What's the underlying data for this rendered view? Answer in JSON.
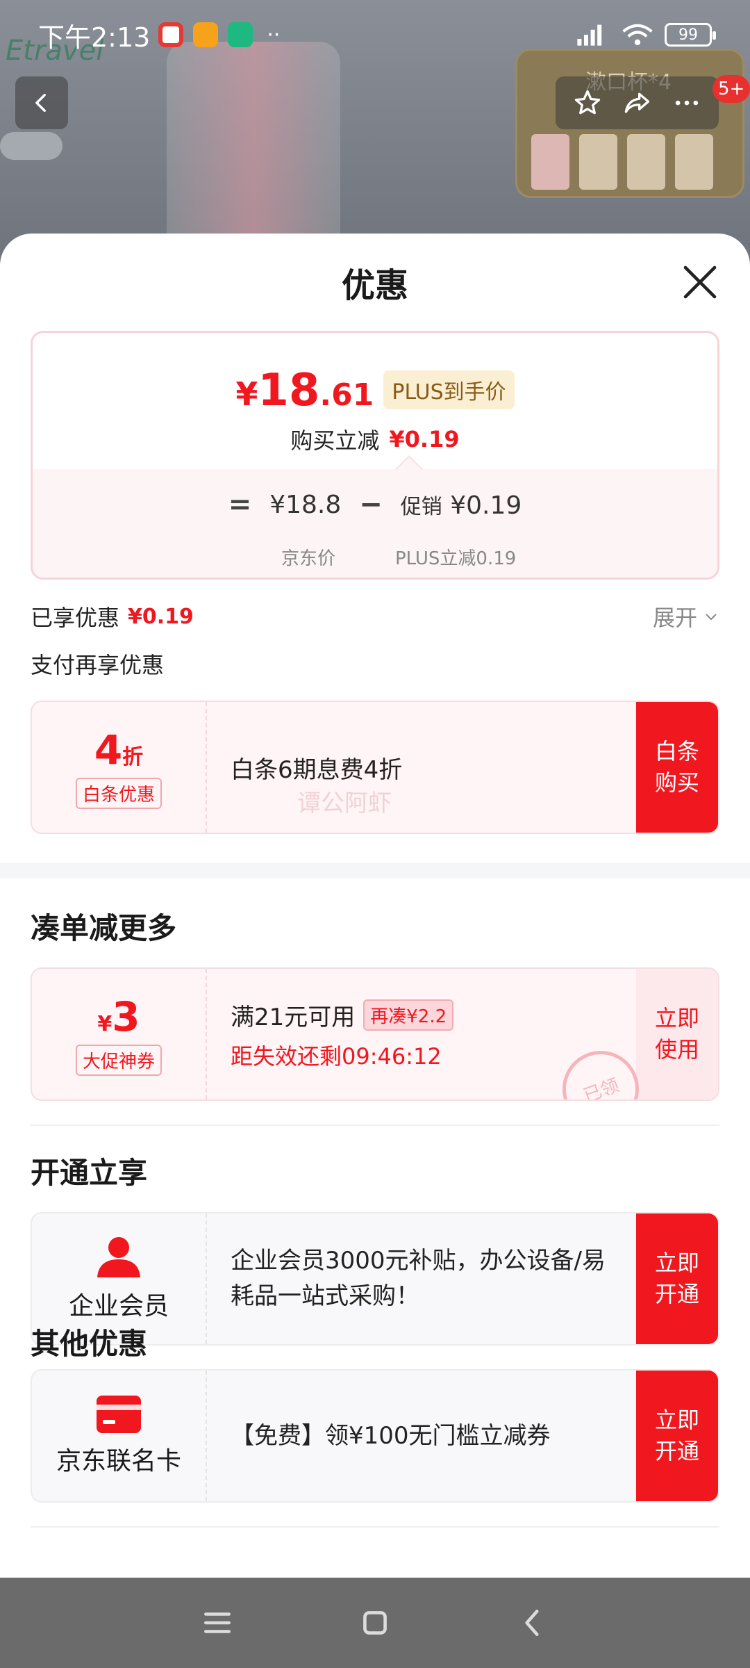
{
  "status_bar": {
    "time": "下午2:13",
    "battery": "99"
  },
  "background": {
    "brand": "Etravel",
    "thumb_title": "漱口杯*4",
    "cart_count": "5+"
  },
  "sheet": {
    "title": "优惠"
  },
  "price_card": {
    "currency": "¥",
    "price_int": "18",
    "price_dec": ".61",
    "plus_tag": "PLUS到手价",
    "instant_label": "购买立减",
    "instant_value": "¥0.19",
    "eq": "=",
    "jd_price": "¥18.8",
    "minus": "−",
    "promo_label": "促销",
    "promo_value": "¥0.19",
    "jd_price_label": "京东价",
    "plus_discount_label": "PLUS立减0.19"
  },
  "enjoyed": {
    "label": "已享优惠",
    "value": "¥0.19",
    "expand": "展开"
  },
  "pay_more": "支付再享优惠",
  "baitiao": {
    "big": "4",
    "unit": "折",
    "tag": "白条优惠",
    "desc": "白条6期息费4折",
    "watermark": "谭公阿虾",
    "action": "白条购买"
  },
  "bundle": {
    "title": "凑单减更多",
    "currency": "¥",
    "amount": "3",
    "tag": "大促神券",
    "condition": "满21元可用",
    "again_tag": "再凑¥2.2",
    "countdown": "距失效还剩09:46:12",
    "action": "立即使用",
    "stamp": "已领"
  },
  "open_now": {
    "title": "开通立享",
    "items": [
      {
        "name": "企业会员",
        "desc": "企业会员3000元补贴，办公设备/易耗品一站式采购！",
        "action": "立即开通",
        "icon": "person-icon"
      },
      {
        "name": "京东联名卡",
        "desc": "【免费】领¥100无门槛立减券",
        "action": "立即开通",
        "icon": "credit-card-icon"
      }
    ]
  },
  "other": {
    "title": "其他优惠"
  },
  "colors": {
    "accent_red": "#f0171f",
    "plus_gold": "#8a5a17"
  }
}
